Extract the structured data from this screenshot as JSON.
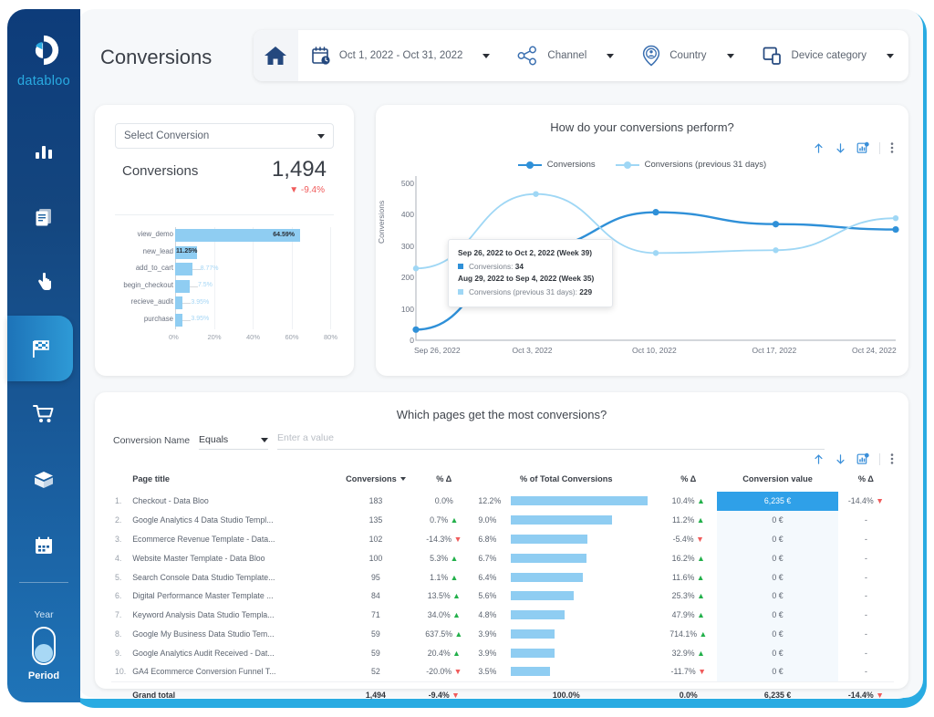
{
  "brand": {
    "name": "databloo",
    "accent": "#29abe2"
  },
  "header": {
    "title": "Conversions",
    "home_icon": "home-icon",
    "filters": [
      {
        "icon": "calendar-clock-icon",
        "label": "Oct 1, 2022 - Oct 31, 2022"
      },
      {
        "icon": "share-nodes-icon",
        "label": "Channel"
      },
      {
        "icon": "location-pin-user-icon",
        "label": "Country"
      },
      {
        "icon": "devices-icon",
        "label": "Device category"
      }
    ]
  },
  "sidebar": {
    "items": [
      {
        "icon": "bar-chart-icon",
        "active": false
      },
      {
        "icon": "document-icon",
        "active": false
      },
      {
        "icon": "click-hand-icon",
        "active": false
      },
      {
        "icon": "checkered-flag-icon",
        "active": true
      },
      {
        "icon": "shopping-cart-icon",
        "active": false
      },
      {
        "icon": "box-package-icon",
        "active": false
      },
      {
        "icon": "calendar-icon",
        "active": false
      }
    ],
    "period": {
      "top_label": "Year",
      "bottom_label": "Period"
    }
  },
  "conversion_card": {
    "select_label": "Select Conversion",
    "kpi_label": "Conversions",
    "kpi_value": "1,494",
    "kpi_delta": "-9.4%",
    "kpi_delta_dir": "down"
  },
  "perform_card": {
    "title": "How do your conversions perform?",
    "icons": [
      "arrow-up-icon",
      "arrow-down-icon",
      "export-chart-icon",
      "more-vertical-icon"
    ],
    "tooltip": {
      "head1": "Sep 26, 2022 to Oct 2, 2022 (Week 39)",
      "row1_label": "Conversions:",
      "row1_value": "34",
      "head2": "Aug 29, 2022 to Sep 4, 2022 (Week 35)",
      "row2_label": "Conversions (previous 31 days):",
      "row2_value": "229"
    }
  },
  "pages_card": {
    "title": "Which pages get the most conversions?",
    "filter": {
      "label": "Conversion Name",
      "operator": "Equals",
      "value_placeholder": "Enter a value"
    },
    "icons": [
      "arrow-up-icon",
      "arrow-down-icon",
      "export-chart-icon",
      "more-vertical-icon"
    ],
    "columns": [
      "Page title",
      "Conversions",
      "% Δ",
      "% of Total Conversions",
      "% Δ",
      "Conversion value",
      "% Δ"
    ],
    "rows": [
      {
        "idx": "1.",
        "title": "Checkout - Data Bloo",
        "conversions": "183",
        "d1": "0.0%",
        "d1dir": "none",
        "pct": "12.2%",
        "pctval": 12.2,
        "d2": "10.4%",
        "d2dir": "up",
        "value": "6,235 €",
        "highlight": true,
        "d3": "-14.4%",
        "d3dir": "down"
      },
      {
        "idx": "2.",
        "title": "Google Analytics 4 Data Studio Templ...",
        "conversions": "135",
        "d1": "0.7%",
        "d1dir": "up",
        "pct": "9.0%",
        "pctval": 9.0,
        "d2": "11.2%",
        "d2dir": "up",
        "value": "0 €",
        "highlight": false,
        "d3": "-",
        "d3dir": "none"
      },
      {
        "idx": "3.",
        "title": "Ecommerce Revenue Template - Data...",
        "conversions": "102",
        "d1": "-14.3%",
        "d1dir": "down",
        "pct": "6.8%",
        "pctval": 6.8,
        "d2": "-5.4%",
        "d2dir": "down",
        "value": "0 €",
        "highlight": false,
        "d3": "-",
        "d3dir": "none"
      },
      {
        "idx": "4.",
        "title": "Website Master Template - Data Bloo",
        "conversions": "100",
        "d1": "5.3%",
        "d1dir": "up",
        "pct": "6.7%",
        "pctval": 6.7,
        "d2": "16.2%",
        "d2dir": "up",
        "value": "0 €",
        "highlight": false,
        "d3": "-",
        "d3dir": "none"
      },
      {
        "idx": "5.",
        "title": "Search Console Data Studio Template...",
        "conversions": "95",
        "d1": "1.1%",
        "d1dir": "up",
        "pct": "6.4%",
        "pctval": 6.4,
        "d2": "11.6%",
        "d2dir": "up",
        "value": "0 €",
        "highlight": false,
        "d3": "-",
        "d3dir": "none"
      },
      {
        "idx": "6.",
        "title": "Digital Performance Master Template ...",
        "conversions": "84",
        "d1": "13.5%",
        "d1dir": "up",
        "pct": "5.6%",
        "pctval": 5.6,
        "d2": "25.3%",
        "d2dir": "up",
        "value": "0 €",
        "highlight": false,
        "d3": "-",
        "d3dir": "none"
      },
      {
        "idx": "7.",
        "title": "Keyword Analysis Data Studio Templa...",
        "conversions": "71",
        "d1": "34.0%",
        "d1dir": "up",
        "pct": "4.8%",
        "pctval": 4.8,
        "d2": "47.9%",
        "d2dir": "up",
        "value": "0 €",
        "highlight": false,
        "d3": "-",
        "d3dir": "none"
      },
      {
        "idx": "8.",
        "title": "Google My Business Data Studio Tem...",
        "conversions": "59",
        "d1": "637.5%",
        "d1dir": "up",
        "pct": "3.9%",
        "pctval": 3.9,
        "d2": "714.1%",
        "d2dir": "up",
        "value": "0 €",
        "highlight": false,
        "d3": "-",
        "d3dir": "none"
      },
      {
        "idx": "9.",
        "title": "Google Analytics Audit Received - Dat...",
        "conversions": "59",
        "d1": "20.4%",
        "d1dir": "up",
        "pct": "3.9%",
        "pctval": 3.9,
        "d2": "32.9%",
        "d2dir": "up",
        "value": "0 €",
        "highlight": false,
        "d3": "-",
        "d3dir": "none"
      },
      {
        "idx": "10.",
        "title": "GA4 Ecommerce Conversion Funnel T...",
        "conversions": "52",
        "d1": "-20.0%",
        "d1dir": "down",
        "pct": "3.5%",
        "pctval": 3.5,
        "d2": "-11.7%",
        "d2dir": "down",
        "value": "0 €",
        "highlight": false,
        "d3": "-",
        "d3dir": "none"
      }
    ],
    "total": {
      "label": "Grand total",
      "conversions": "1,494",
      "d1": "-9.4%",
      "d1dir": "down",
      "pct": "100.0%",
      "d2": "0.0%",
      "d2dir": "none",
      "value": "6,235 €",
      "d3": "-14.4%",
      "d3dir": "down"
    }
  },
  "chart_data": [
    {
      "type": "bar",
      "orientation": "horizontal",
      "title": "",
      "categories": [
        "view_demo",
        "new_lead",
        "add_to_cart",
        "begin_checkout",
        "recieve_audit",
        "purchase"
      ],
      "values": [
        64.59,
        11.25,
        8.77,
        7.5,
        3.95,
        3.95
      ],
      "value_labels": [
        "64.59%",
        "11.25%",
        "8.77%",
        "7.5%",
        "3.95%",
        "3.95%"
      ],
      "xlabel": "",
      "ylabel": "",
      "xlim": [
        0,
        80
      ],
      "xticks": [
        "0%",
        "20%",
        "40%",
        "60%",
        "80%"
      ],
      "grid": true,
      "bar_color": "#8fcdf2"
    },
    {
      "type": "line",
      "title": "How do your conversions perform?",
      "xlabel": "",
      "ylabel": "Conversions",
      "ylim": [
        0,
        500
      ],
      "yticks": [
        "0",
        "100",
        "200",
        "300",
        "400",
        "500"
      ],
      "x": [
        "Sep 26, 2022",
        "Oct 3, 2022",
        "Oct 10, 2022",
        "Oct 17, 2022",
        "Oct 24, 2022"
      ],
      "legend_position": "top-center",
      "grid": false,
      "series": [
        {
          "name": "Conversions",
          "color": "#2f90d8",
          "values": [
            34,
            295,
            408,
            370,
            353
          ]
        },
        {
          "name": "Conversions (previous 31 days)",
          "color": "#9fd7f5",
          "values": [
            229,
            466,
            278,
            287,
            389
          ]
        }
      ]
    }
  ]
}
